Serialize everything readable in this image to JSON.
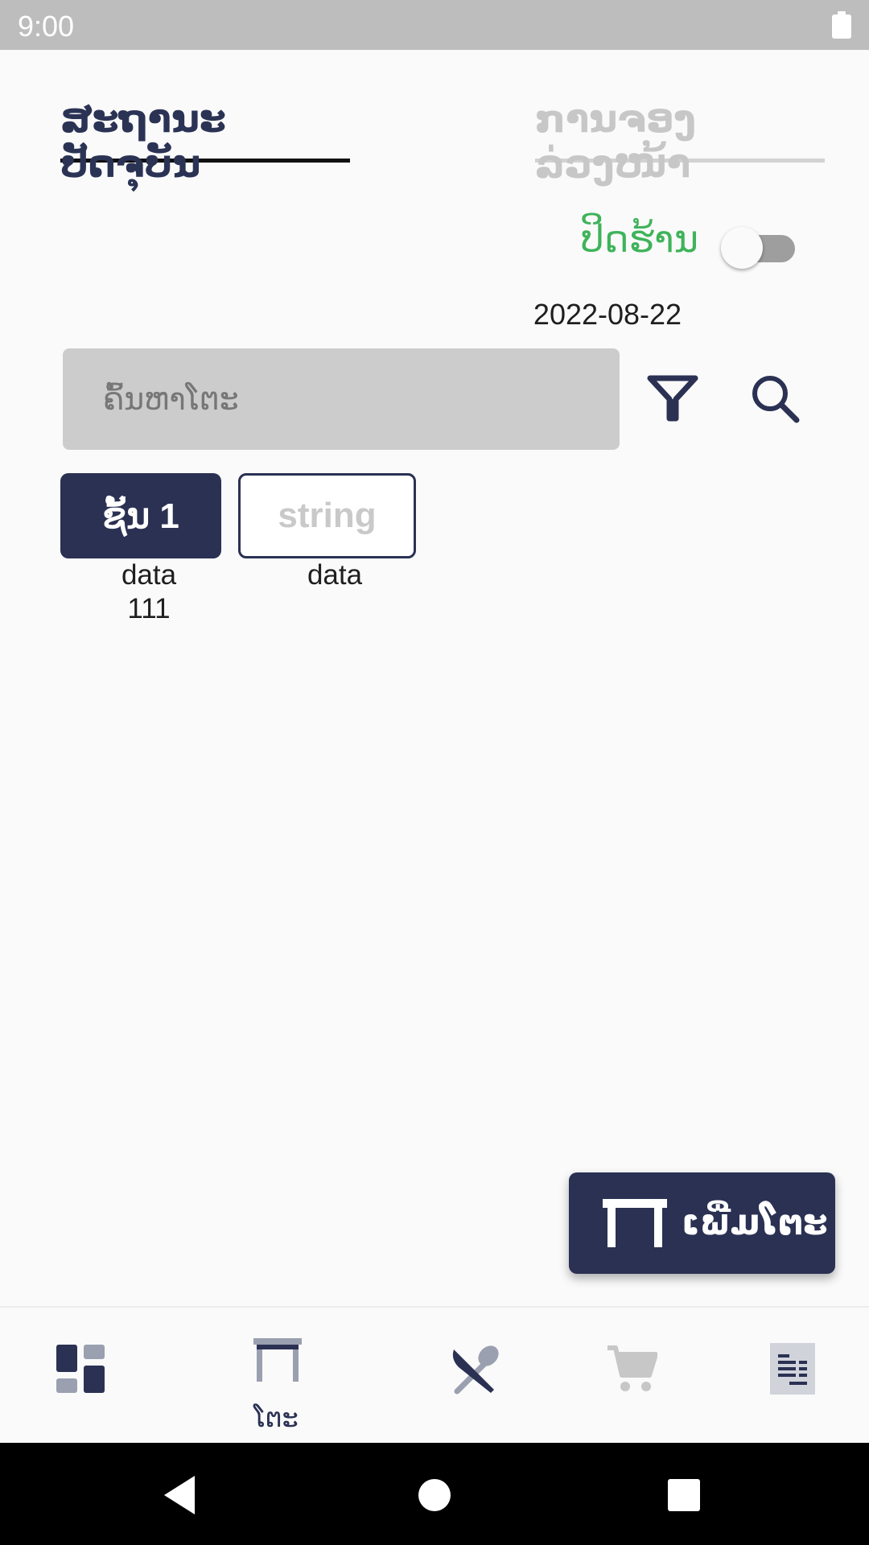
{
  "status_bar": {
    "time": "9:00"
  },
  "tabs": [
    {
      "label": "ສະຖານະປັດຈຸບັນ",
      "active": true
    },
    {
      "label": "ການຈອງລ່ວງໜ້າ",
      "active": false
    }
  ],
  "shop_status": {
    "label": "ປິດຮ້ານ",
    "toggle_on": false
  },
  "date": "2022-08-22",
  "search": {
    "placeholder": "ຄົ້ນຫາໂຕະ",
    "value": ""
  },
  "floors": [
    {
      "label": "ຊັ້ນ 1",
      "sub": "data",
      "sub2": "111",
      "selected": true
    },
    {
      "label": "string",
      "sub": "data",
      "selected": false
    }
  ],
  "add_table": {
    "label": "ເພີ່ມໂຕະ"
  },
  "bottom_nav": {
    "items": [
      {
        "icon": "dashboard-icon",
        "label": ""
      },
      {
        "icon": "table-icon",
        "label": "ໂຕະ",
        "active": true
      },
      {
        "icon": "cutlery-icon",
        "label": ""
      },
      {
        "icon": "cart-icon",
        "label": ""
      },
      {
        "icon": "receipt-icon",
        "label": ""
      }
    ]
  },
  "colors": {
    "primary": "#2a3153",
    "open_label": "#3fb35a",
    "status_bar": "#bdbdbd",
    "inactive": "#c7c7c7"
  }
}
